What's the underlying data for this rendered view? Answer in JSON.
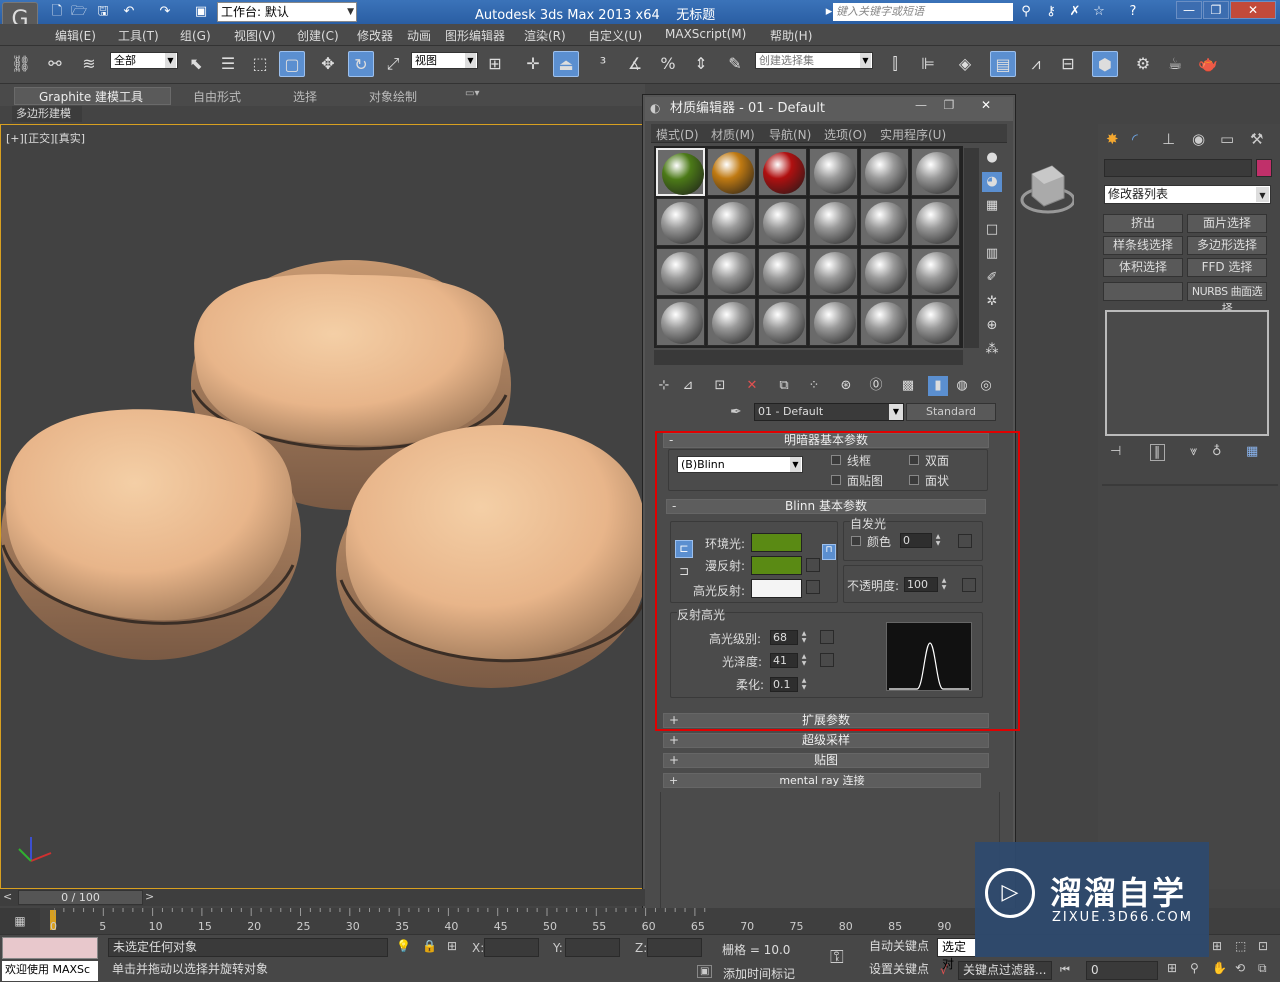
{
  "titlebar": {
    "workspace_label": "工作台: 默认",
    "app_title": "Autodesk 3ds Max  2013 x64",
    "doc_title": "无标题",
    "search_placeholder": "键入关键字或短语",
    "min_btn": "—",
    "max_btn": "❐",
    "close_btn": "✕"
  },
  "menu": [
    "编辑(E)",
    "工具(T)",
    "组(G)",
    "视图(V)",
    "创建(C)",
    "修改器",
    "动画",
    "图形编辑器",
    "渲染(R)",
    "自定义(U)",
    "MAXScript(M)",
    "帮助(H)"
  ],
  "toolbar": {
    "filter_value": "全部",
    "ref_coord_value": "视图",
    "selection_set_placeholder": "创建选择集"
  },
  "ribbon": {
    "tabs": [
      "Graphite 建模工具",
      "自由形式",
      "选择",
      "对象绘制"
    ],
    "subtab": "多边形建模"
  },
  "viewport": {
    "label_parts": [
      "[+]",
      "[正交]",
      "[真实]"
    ]
  },
  "cmd_panel": {
    "modifier_list": "修改器列表",
    "buttons": [
      "挤出",
      "面片选择",
      "样条线选择",
      "多边形选择",
      "体积选择",
      "FFD 选择",
      "",
      "NURBS 曲面选择"
    ]
  },
  "material_editor": {
    "title": "材质编辑器 - 01 - Default",
    "menu": [
      "模式(D)",
      "材质(M)",
      "导航(N)",
      "选项(O)",
      "实用程序(U)"
    ],
    "material_name": "01 - Default",
    "material_type": "Standard",
    "shader_rollout": {
      "title": "明暗器基本参数",
      "shader": "(B)Blinn",
      "wire": "线框",
      "two_sided": "双面",
      "face_map": "面贴图",
      "faceted": "面状"
    },
    "blinn_rollout": {
      "title": "Blinn 基本参数",
      "self_illum_title": "自发光",
      "color_label": "颜色",
      "color_value": "0",
      "ambient_label": "环境光:",
      "diffuse_label": "漫反射:",
      "specular_label": "高光反射:",
      "ambient_color": "#5a8a14",
      "diffuse_color": "#5a8a14",
      "specular_color": "#f4f4f4",
      "opacity_label": "不透明度:",
      "opacity_value": "100",
      "spec_highlights_title": "反射高光",
      "spec_level_label": "高光级别:",
      "spec_level_value": "68",
      "glossiness_label": "光泽度:",
      "glossiness_value": "41",
      "soften_label": "柔化:",
      "soften_value": "0.1"
    },
    "collapsed_rollouts": [
      "扩展参数",
      "超级采样",
      "贴图",
      "mental ray 连接"
    ],
    "slot_colors": [
      "#4c7a18",
      "#c07a12",
      "#b01010"
    ]
  },
  "timeline": {
    "frame_display": "0 / 100",
    "ticks": [
      "0",
      "5",
      "10",
      "15",
      "20",
      "25",
      "30",
      "35",
      "40",
      "45",
      "50",
      "55",
      "60",
      "65",
      "70",
      "75",
      "80",
      "85",
      "90"
    ]
  },
  "status": {
    "welcome": "欢迎使用 MAXSc",
    "selection_status": "未选定任何对象",
    "prompt": "单击并拖动以选择并旋转对象",
    "x_label": "X:",
    "y_label": "Y:",
    "z_label": "Z:",
    "grid": "栅格 = 10.0",
    "add_time_tag": "添加时间标记",
    "auto_key": "自动关键点",
    "set_key": "设置关键点",
    "selected_obj": "选定对",
    "key_filters": "关键点过滤器...",
    "frame_value": "0"
  },
  "watermark": {
    "main": "溜溜自学",
    "sub": "ZIXUE.3D66.COM",
    "logo_glyph": "▷"
  }
}
